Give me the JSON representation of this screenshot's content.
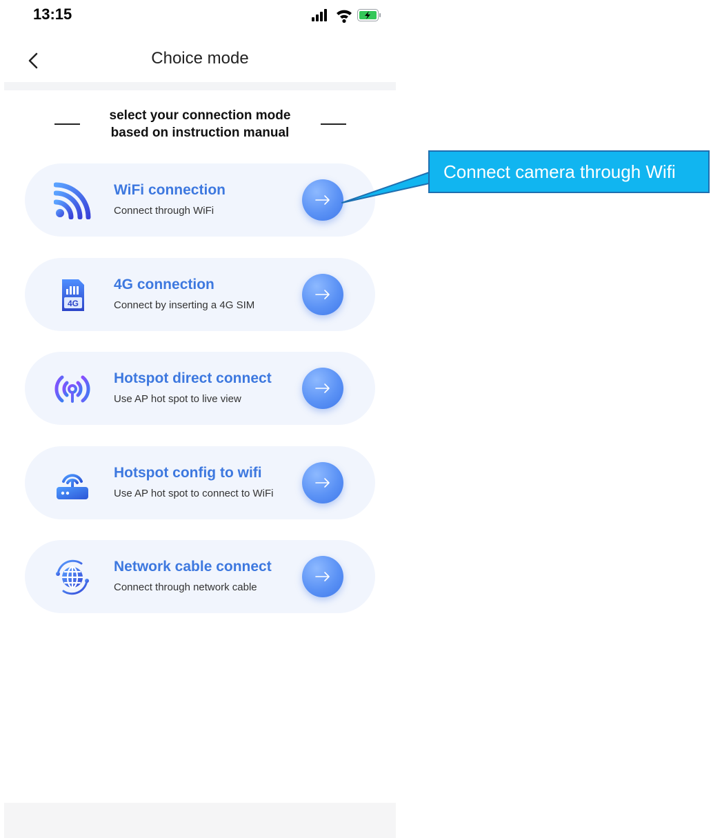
{
  "status_bar": {
    "time": "13:15",
    "icons": [
      "signal-icon",
      "wifi-icon",
      "battery-charging-icon"
    ]
  },
  "nav": {
    "back_icon": "chevron-left-icon",
    "title": "Choice mode"
  },
  "heading": {
    "line1": "select your connection mode",
    "line2": "based on instruction manual"
  },
  "options": [
    {
      "icon": "wifi-icon",
      "title": "WiFi connection",
      "subtitle": "Connect through WiFi"
    },
    {
      "icon": "sim-card-4g-icon",
      "title": "4G connection",
      "subtitle": "Connect by inserting a 4G SIM"
    },
    {
      "icon": "hotspot-icon",
      "title": "Hotspot direct connect",
      "subtitle": "Use AP hot spot to live view"
    },
    {
      "icon": "router-icon",
      "title": "Hotspot config to wifi",
      "subtitle": "Use AP hot spot to connect to WiFi"
    },
    {
      "icon": "network-globe-icon",
      "title": "Network cable connect",
      "subtitle": "Connect through network cable"
    }
  ],
  "callout": {
    "text": "Connect camera through Wifi"
  },
  "colors": {
    "accent": "#3d78df",
    "card_bg": "#f1f5fd",
    "callout_bg": "#11b5f0"
  }
}
